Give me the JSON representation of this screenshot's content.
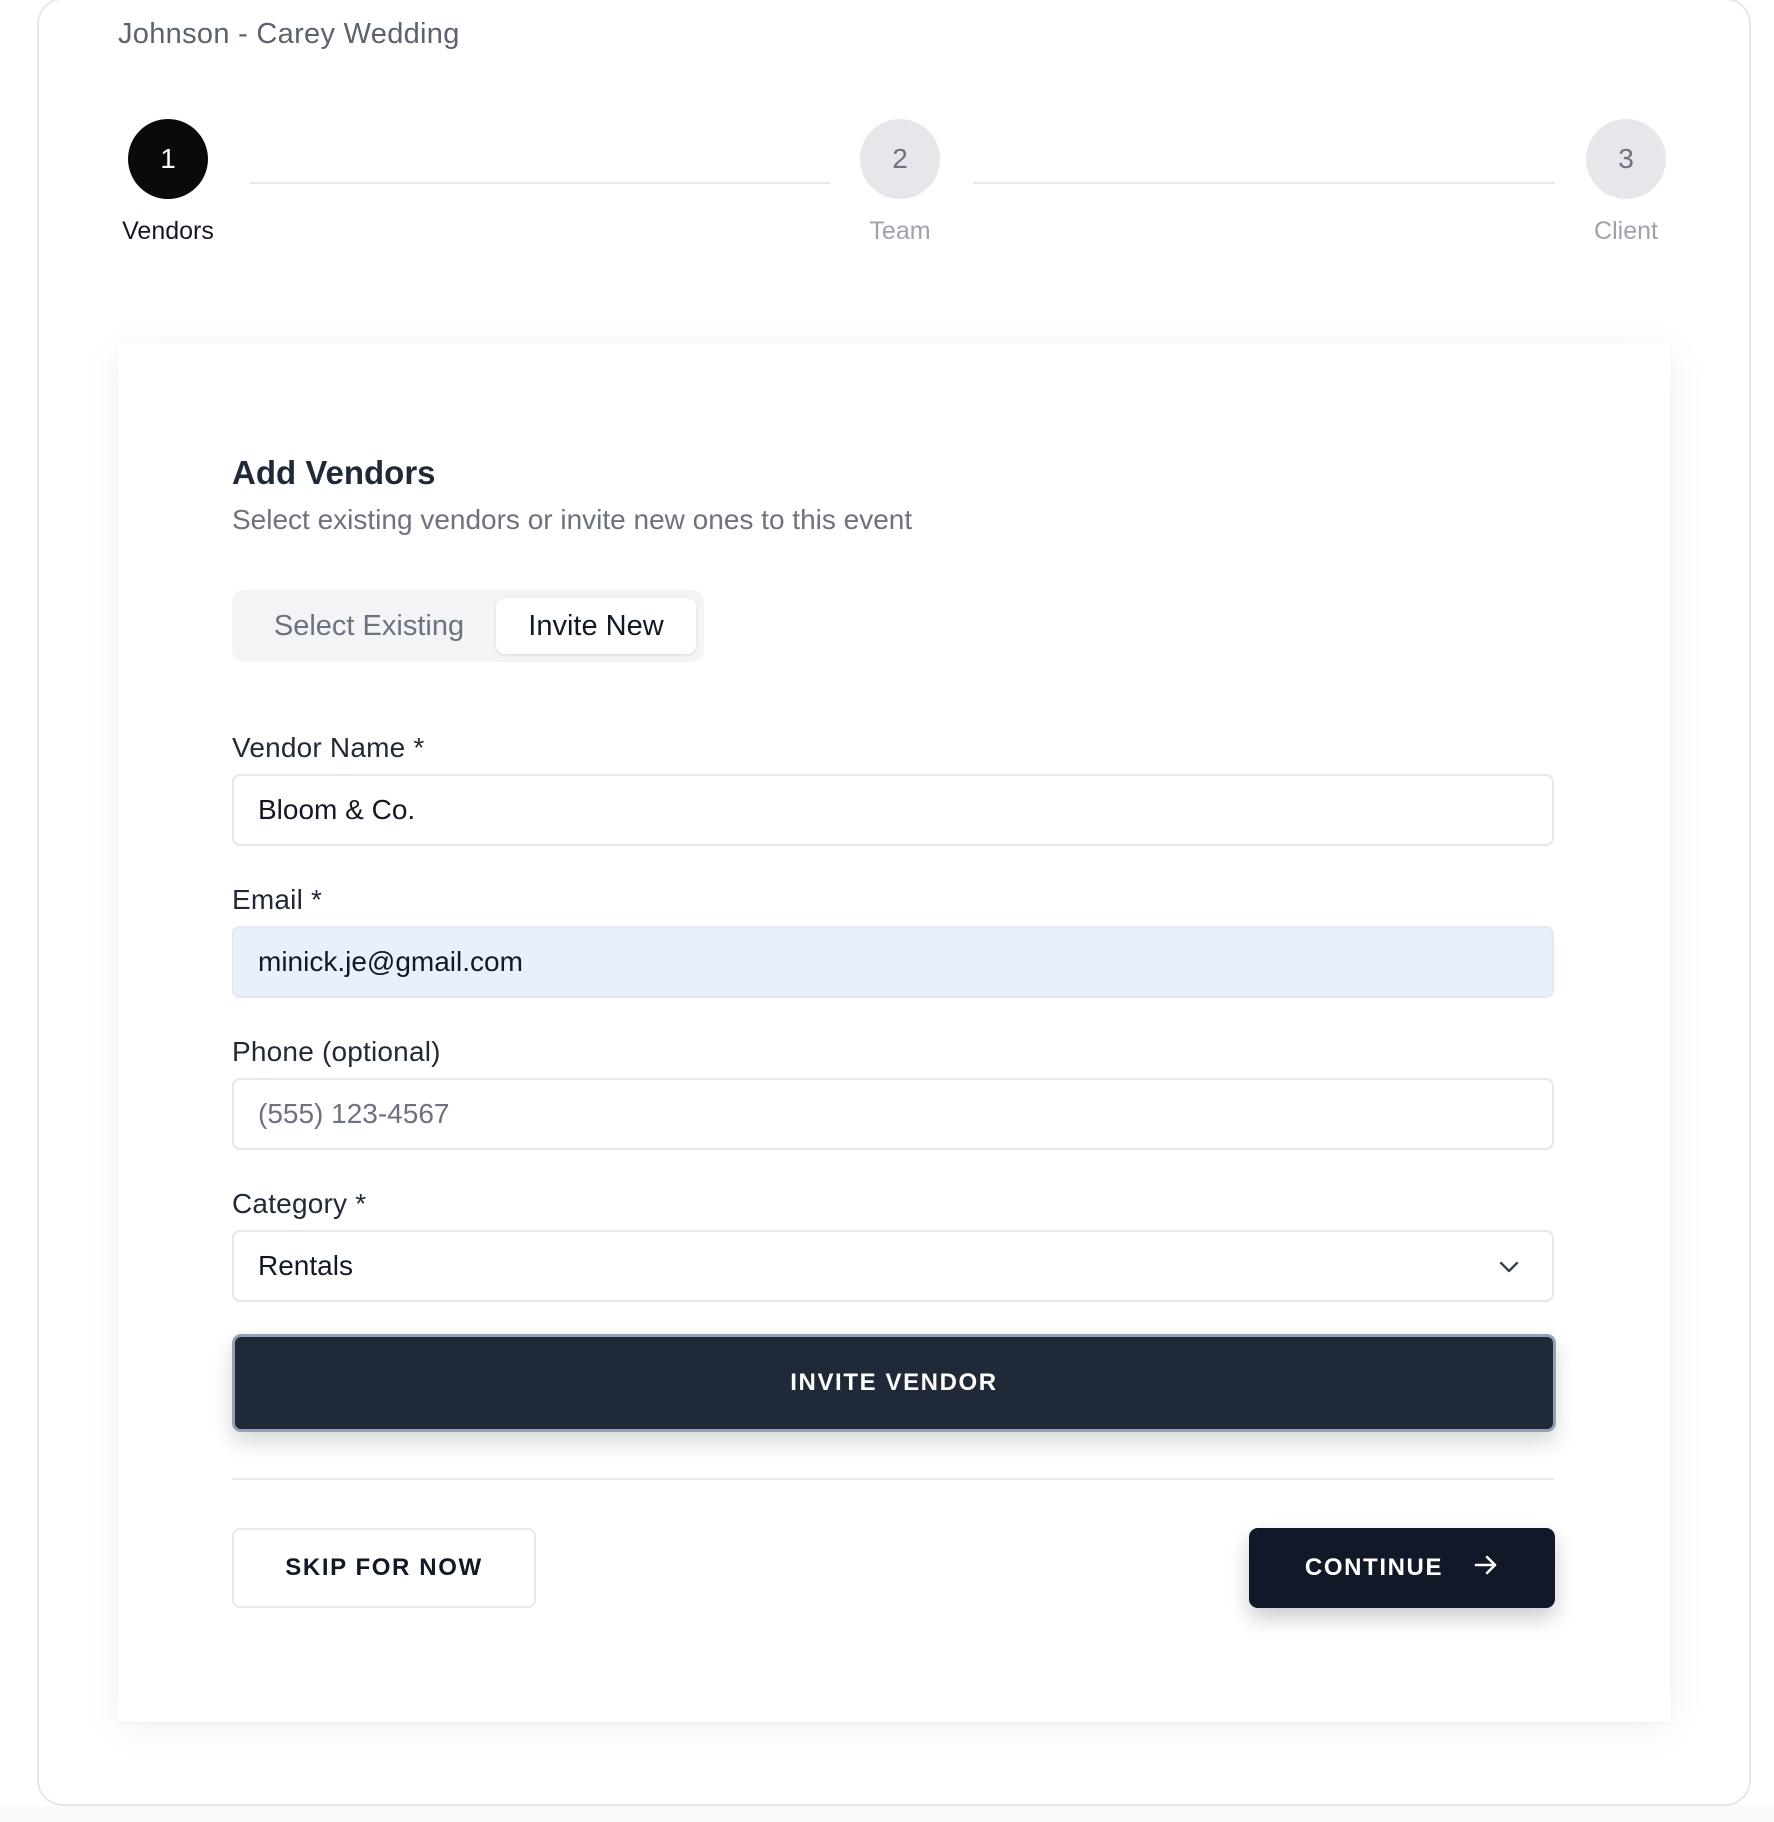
{
  "event": {
    "title": "Johnson - Carey Wedding"
  },
  "stepper": {
    "steps": [
      {
        "number": "1",
        "label": "Vendors",
        "state": "active"
      },
      {
        "number": "2",
        "label": "Team",
        "state": "inactive"
      },
      {
        "number": "3",
        "label": "Client",
        "state": "inactive"
      }
    ]
  },
  "card": {
    "title": "Add Vendors",
    "subtitle": "Select existing vendors or invite new ones to this event",
    "tabs": {
      "existing": "Select Existing",
      "new": "Invite New",
      "selected": "Invite New"
    },
    "form": {
      "vendor_name": {
        "label": "Vendor Name *",
        "value": "Bloom & Co."
      },
      "email": {
        "label": "Email *",
        "value": "minick.je@gmail.com"
      },
      "phone": {
        "label": "Phone (optional)",
        "placeholder": "(555) 123-4567",
        "value": ""
      },
      "category": {
        "label": "Category *",
        "value": "Rentals",
        "icon": "chevron-down-icon"
      }
    },
    "invite_button": "INVITE VENDOR",
    "skip_button": "SKIP FOR NOW",
    "continue_button": {
      "label": "CONTINUE",
      "icon": "arrow-right-icon"
    }
  },
  "colors": {
    "primary": "#111827",
    "invite_button": "#1f2937",
    "autofill": "#e8f0fe",
    "border": "#e5e7eb",
    "muted_text": "#6b7280"
  }
}
